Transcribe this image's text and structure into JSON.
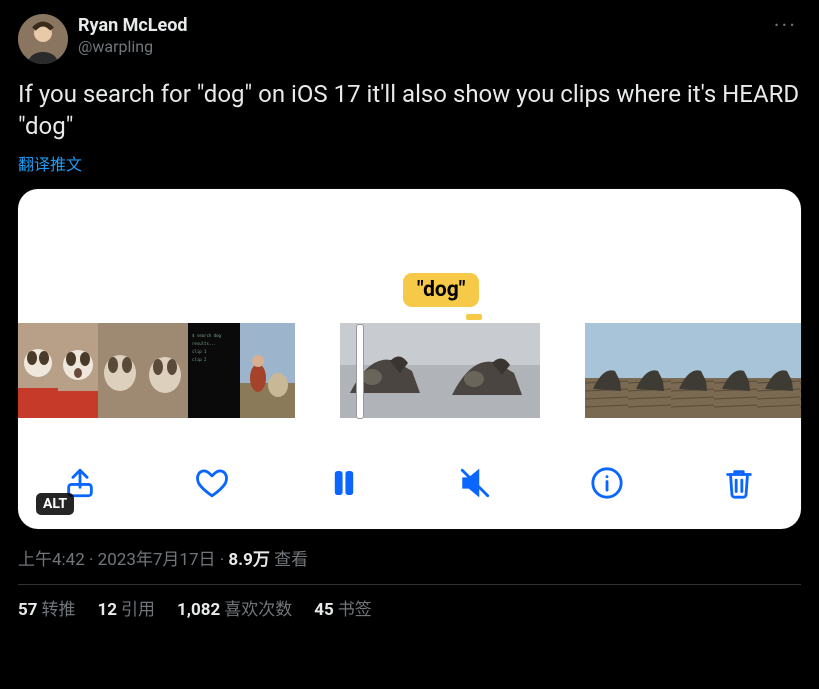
{
  "author": {
    "display_name": "Ryan McLeod",
    "handle": "@warpling"
  },
  "more_glyph": "···",
  "body": "If you search for \"dog\" on iOS 17 it'll also show you clips where it's HEARD \"dog\"",
  "translate_label": "翻译推文",
  "media": {
    "tooltip": "\"dog\"",
    "alt_label": "ALT",
    "controls": {
      "share": "share-icon",
      "like": "heart-icon",
      "pause": "pause-icon",
      "mute": "speaker-muted-icon",
      "info": "info-icon",
      "delete": "trash-icon"
    }
  },
  "meta": {
    "time": "上午4:42",
    "dot1": " · ",
    "date": "2023年7月17日",
    "dot2": " · ",
    "views_value": "8.9万",
    "views_label": " 查看"
  },
  "stats": {
    "retweets_n": "57",
    "retweets_l": "转推",
    "quotes_n": "12",
    "quotes_l": "引用",
    "likes_n": "1,082",
    "likes_l": "喜欢次数",
    "bookmarks_n": "45",
    "bookmarks_l": "书签"
  }
}
